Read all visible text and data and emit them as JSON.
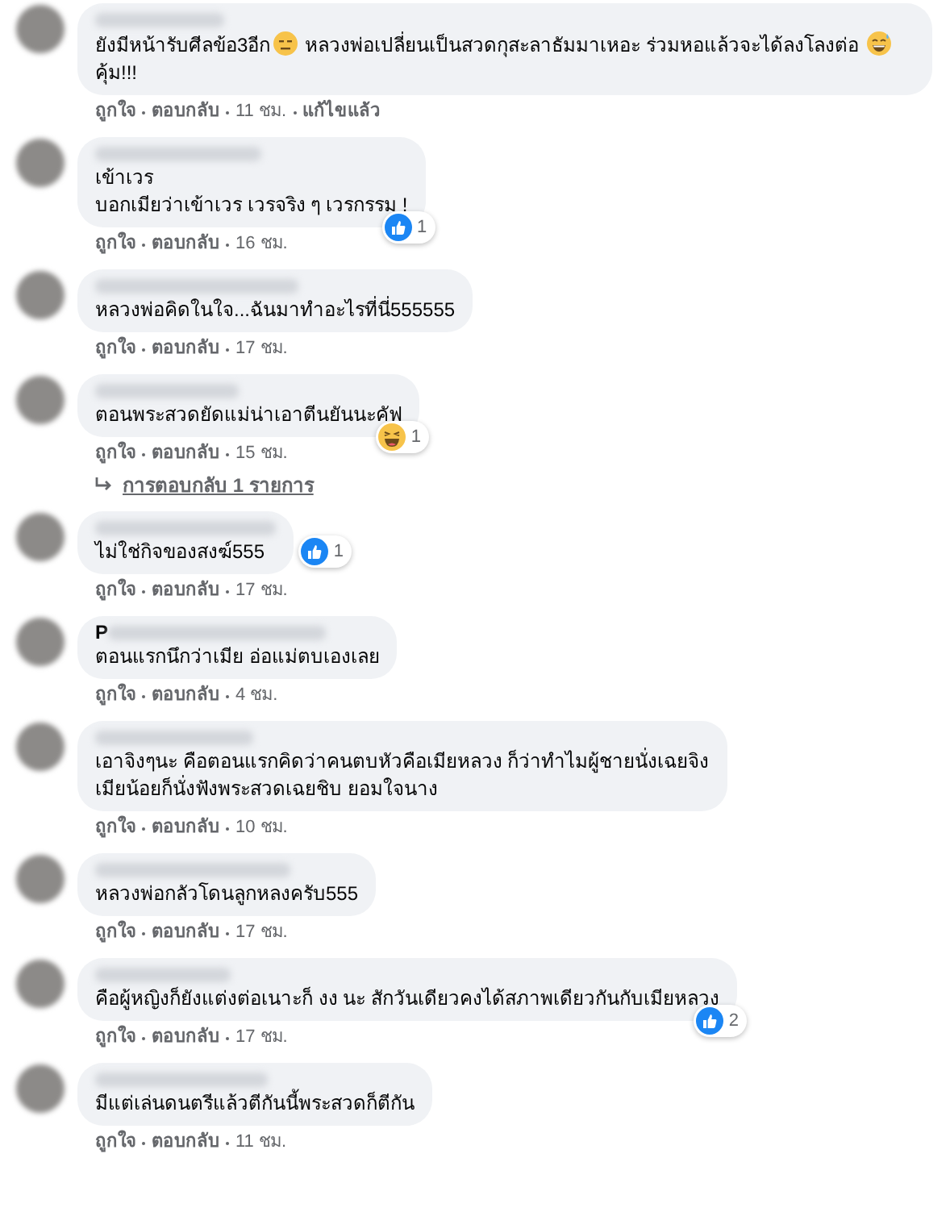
{
  "comments": [
    {
      "segments": [
        {
          "kind": "text",
          "text": "ยังมีหน้ารับศีลข้อ3อีก"
        },
        {
          "kind": "emoji-flat"
        },
        {
          "kind": "text",
          "text": " หลวงพ่อเปลี่ยนเป็นสวดกุสะลาธัมมาเหอะ ร่วมหอแล้วจะได้ลงโลงต่อ "
        },
        {
          "kind": "emoji-sweat"
        },
        {
          "kind": "text",
          "text": " คุ้ม!!!"
        }
      ],
      "like": "ถูกใจ",
      "reply": "ตอบกลับ",
      "time": "11 ชม.",
      "edited": "แก้ไขแล้ว"
    },
    {
      "segments": [
        {
          "kind": "text",
          "text": "เข้าเวร"
        },
        {
          "kind": "break"
        },
        {
          "kind": "text",
          "text": "บอกเมียว่าเข้าเวร เวรจริง ๆ เวรกรรม !"
        }
      ],
      "reaction": {
        "kind": "like",
        "count": "1"
      },
      "like": "ถูกใจ",
      "reply": "ตอบกลับ",
      "time": "16 ชม."
    },
    {
      "segments": [
        {
          "kind": "text",
          "text": "หลวงพ่อคิดในใจ...ฉันมาทำอะไรที่นี่555555"
        }
      ],
      "like": "ถูกใจ",
      "reply": "ตอบกลับ",
      "time": "17 ชม."
    },
    {
      "segments": [
        {
          "kind": "text",
          "text": "ตอนพระสวดยัดแม่น่าเอาตีนยันนะคัฟ"
        }
      ],
      "reaction": {
        "kind": "haha",
        "count": "1"
      },
      "like": "ถูกใจ",
      "reply": "ตอบกลับ",
      "time": "15 ชม.",
      "replies_link": "การตอบกลับ 1 รายการ"
    },
    {
      "segments": [
        {
          "kind": "text",
          "text": "ไม่ใช่กิจของสงฆ์555"
        }
      ],
      "reaction": {
        "kind": "like",
        "count": "1",
        "beside_text": true
      },
      "like": "ถูกใจ",
      "reply": "ตอบกลับ",
      "time": "17 ชม."
    },
    {
      "name_visible": "P",
      "segments": [
        {
          "kind": "text",
          "text": "ตอนแรกนึกว่าเมีย อ่อแม่ตบเองเลย"
        }
      ],
      "like": "ถูกใจ",
      "reply": "ตอบกลับ",
      "time": "4 ชม."
    },
    {
      "segments": [
        {
          "kind": "text",
          "text": "เอาจิงๆนะ คือตอนแรกคิดว่าคนตบหัวคือเมียหลวง ก็ว่าทำไมผู้ชายนั่งเฉยจิง"
        },
        {
          "kind": "break"
        },
        {
          "kind": "text",
          "text": "เมียน้อยก็นั่งฟังพระสวดเฉยชิบ ยอมใจนาง"
        }
      ],
      "like": "ถูกใจ",
      "reply": "ตอบกลับ",
      "time": "10 ชม."
    },
    {
      "segments": [
        {
          "kind": "text",
          "text": "หลวงพ่อกลัวโดนลูกหลงครับ555"
        }
      ],
      "like": "ถูกใจ",
      "reply": "ตอบกลับ",
      "time": "17 ชม."
    },
    {
      "segments": [
        {
          "kind": "text",
          "text": "คือผู้หญิงก็ยังแต่งต่อเนาะก็ งง นะ สักวันเดียวคงได้สภาพเดียวกันกับเมียหลวง"
        }
      ],
      "reaction": {
        "kind": "like",
        "count": "2"
      },
      "like": "ถูกใจ",
      "reply": "ตอบกลับ",
      "time": "17 ชม."
    },
    {
      "segments": [
        {
          "kind": "text",
          "text": "มีแต่เล่นดนตรีแล้วตีกันนี้พระสวดก็ตีกัน"
        }
      ],
      "like": "ถูกใจ",
      "reply": "ตอบกลับ",
      "time": "11 ชม."
    }
  ]
}
